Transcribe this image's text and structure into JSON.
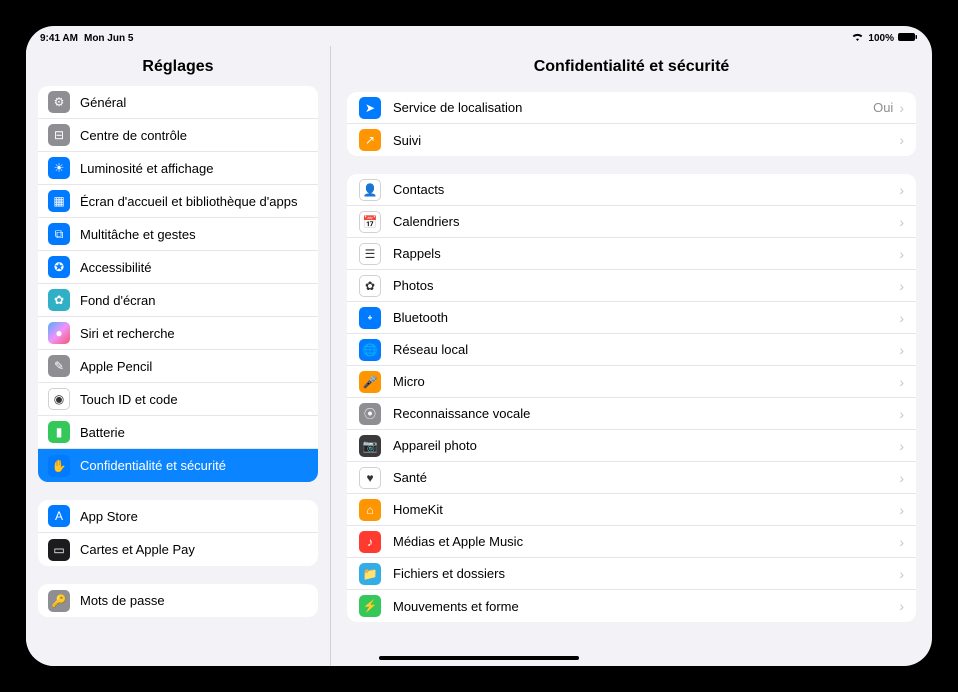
{
  "status": {
    "time": "9:41 AM",
    "date": "Mon Jun 5",
    "battery": "100%"
  },
  "sidebar": {
    "title": "Réglages",
    "groups": [
      {
        "items": [
          {
            "id": "general",
            "label": "Général",
            "icon": "⚙",
            "bg": "bg-gray"
          },
          {
            "id": "control-center",
            "label": "Centre de contrôle",
            "icon": "⊟",
            "bg": "bg-gray"
          },
          {
            "id": "display",
            "label": "Luminosité et affichage",
            "icon": "☀",
            "bg": "bg-blue"
          },
          {
            "id": "home-screen",
            "label": "Écran d'accueil et bibliothèque d'apps",
            "icon": "▦",
            "bg": "bg-blue"
          },
          {
            "id": "multitasking",
            "label": "Multitâche et gestes",
            "icon": "⧉",
            "bg": "bg-blue"
          },
          {
            "id": "accessibility",
            "label": "Accessibilité",
            "icon": "✪",
            "bg": "bg-blue"
          },
          {
            "id": "wallpaper",
            "label": "Fond d'écran",
            "icon": "✿",
            "bg": "bg-teal"
          },
          {
            "id": "siri",
            "label": "Siri et recherche",
            "icon": "●",
            "bg": "bg-sirigr"
          },
          {
            "id": "pencil",
            "label": "Apple Pencil",
            "icon": "✎",
            "bg": "bg-gray"
          },
          {
            "id": "touch-id",
            "label": "Touch ID et code",
            "icon": "◉",
            "bg": "bg-white"
          },
          {
            "id": "battery",
            "label": "Batterie",
            "icon": "▮",
            "bg": "bg-green"
          },
          {
            "id": "privacy",
            "label": "Confidentialité et sécurité",
            "icon": "✋",
            "bg": "bg-blue",
            "selected": true
          }
        ]
      },
      {
        "items": [
          {
            "id": "app-store",
            "label": "App Store",
            "icon": "A",
            "bg": "bg-blue"
          },
          {
            "id": "wallet",
            "label": "Cartes et Apple Pay",
            "icon": "▭",
            "bg": "bg-black"
          }
        ]
      },
      {
        "items": [
          {
            "id": "passwords",
            "label": "Mots de passe",
            "icon": "🔑",
            "bg": "bg-gray"
          }
        ]
      }
    ]
  },
  "content": {
    "title": "Confidentialité et sécurité",
    "sections": [
      {
        "rows": [
          {
            "id": "location",
            "label": "Service de localisation",
            "value": "Oui",
            "icon": "➤",
            "bg": "bg-blue"
          },
          {
            "id": "tracking",
            "label": "Suivi",
            "icon": "↗",
            "bg": "bg-orange"
          }
        ]
      },
      {
        "rows": [
          {
            "id": "contacts",
            "label": "Contacts",
            "icon": "👤",
            "bg": "bg-white"
          },
          {
            "id": "calendars",
            "label": "Calendriers",
            "icon": "📅",
            "bg": "bg-white"
          },
          {
            "id": "reminders",
            "label": "Rappels",
            "icon": "☰",
            "bg": "bg-white"
          },
          {
            "id": "photos",
            "label": "Photos",
            "icon": "✿",
            "bg": "bg-white"
          },
          {
            "id": "bluetooth",
            "label": "Bluetooth",
            "icon": "᛭",
            "bg": "bg-blue"
          },
          {
            "id": "local-network",
            "label": "Réseau local",
            "icon": "🌐",
            "bg": "bg-blue"
          },
          {
            "id": "microphone",
            "label": "Micro",
            "icon": "🎤",
            "bg": "bg-orange"
          },
          {
            "id": "speech",
            "label": "Reconnaissance vocale",
            "icon": "⦿",
            "bg": "bg-gray"
          },
          {
            "id": "camera",
            "label": "Appareil photo",
            "icon": "📷",
            "bg": "bg-dark"
          },
          {
            "id": "health",
            "label": "Santé",
            "icon": "♥",
            "bg": "bg-white"
          },
          {
            "id": "homekit",
            "label": "HomeKit",
            "icon": "⌂",
            "bg": "bg-orange"
          },
          {
            "id": "media",
            "label": "Médias et Apple Music",
            "icon": "♪",
            "bg": "bg-red"
          },
          {
            "id": "files",
            "label": "Fichiers et dossiers",
            "icon": "📁",
            "bg": "bg-cyan"
          },
          {
            "id": "motion",
            "label": "Mouvements et forme",
            "icon": "⚡",
            "bg": "bg-green"
          }
        ]
      }
    ]
  }
}
